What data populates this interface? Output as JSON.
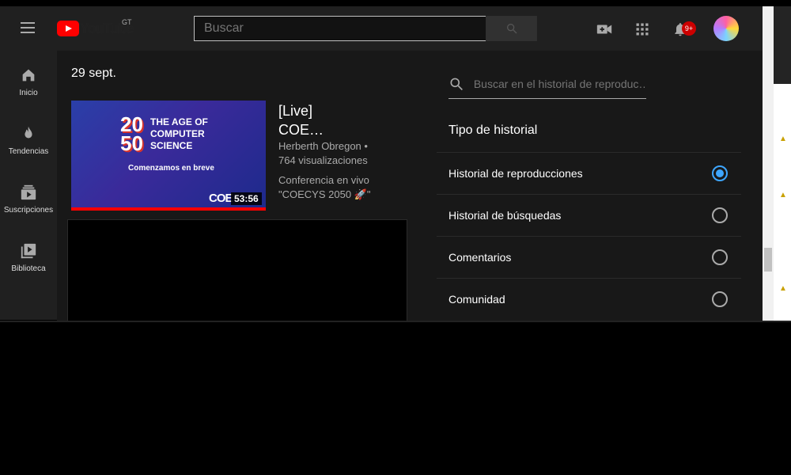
{
  "masthead": {
    "logo_text": "YouTube",
    "country_code": "GT",
    "search_placeholder": "Buscar",
    "notification_badge": "9+"
  },
  "sidebar": {
    "items": [
      {
        "label": "Inicio",
        "icon": "home-icon"
      },
      {
        "label": "Tendencias",
        "icon": "fire-icon"
      },
      {
        "label": "Suscripciones",
        "icon": "subscriptions-icon"
      },
      {
        "label": "Biblioteca",
        "icon": "library-icon"
      }
    ]
  },
  "history": {
    "date": "29 sept.",
    "video": {
      "thumb_number_top": "20",
      "thumb_number_bottom": "50",
      "thumb_title": "THE AGE OF COMPUTER SCIENCE",
      "thumb_subtitle": "Comenzamos en breve",
      "thumb_brand": "COE",
      "duration": "53:56",
      "watched_fraction": 1.0,
      "title_line1": "[Live]",
      "title_line2": "COE…",
      "channel": "Herberth Obregon •",
      "views": "764 visualizaciones",
      "desc_line1": "Conferencia en vivo",
      "desc_line2": "\"COECYS 2050 🚀\""
    }
  },
  "history_panel": {
    "search_placeholder": "Buscar en el historial de reproduc…",
    "heading": "Tipo de historial",
    "options": [
      {
        "label": "Historial de reproducciones",
        "checked": true
      },
      {
        "label": "Historial de búsquedas",
        "checked": false
      },
      {
        "label": "Comentarios",
        "checked": false
      },
      {
        "label": "Comunidad",
        "checked": false
      }
    ]
  },
  "colors": {
    "accent": "#3ea6ff",
    "brand": "#ff0000",
    "badge": "#cc0000",
    "background": "#181818",
    "masthead": "#202020"
  }
}
